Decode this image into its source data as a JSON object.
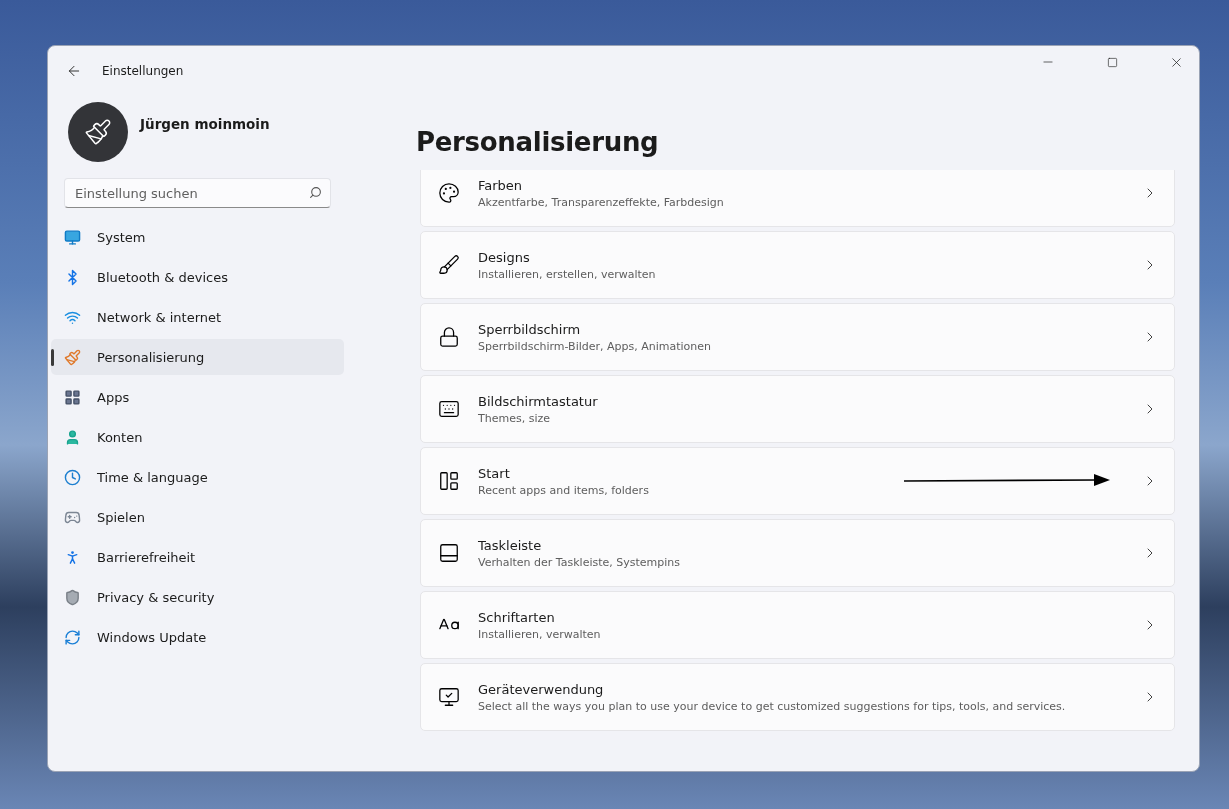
{
  "window": {
    "title": "Einstellungen"
  },
  "profile": {
    "name": "Jürgen moinmoin"
  },
  "search": {
    "placeholder": "Einstellung suchen"
  },
  "sidebar": {
    "items": [
      {
        "label": "System",
        "selected": false
      },
      {
        "label": "Bluetooth & devices",
        "selected": false
      },
      {
        "label": "Network & internet",
        "selected": false
      },
      {
        "label": "Personalisierung",
        "selected": true
      },
      {
        "label": "Apps",
        "selected": false
      },
      {
        "label": "Konten",
        "selected": false
      },
      {
        "label": "Time & language",
        "selected": false
      },
      {
        "label": "Spielen",
        "selected": false
      },
      {
        "label": "Barrierefreiheit",
        "selected": false
      },
      {
        "label": "Privacy & security",
        "selected": false
      },
      {
        "label": "Windows Update",
        "selected": false
      }
    ]
  },
  "page": {
    "title": "Personalisierung",
    "cards": [
      {
        "title": "Farben",
        "subtitle": "Akzentfarbe, Transparenzeffekte, Farbdesign"
      },
      {
        "title": "Designs",
        "subtitle": "Installieren, erstellen, verwalten"
      },
      {
        "title": "Sperrbildschirm",
        "subtitle": "Sperrbildschirm-Bilder, Apps, Animationen"
      },
      {
        "title": "Bildschirmtastatur",
        "subtitle": "Themes, size"
      },
      {
        "title": "Start",
        "subtitle": "Recent apps and items, folders",
        "annotated": true
      },
      {
        "title": "Taskleiste",
        "subtitle": "Verhalten der Taskleiste, Systempins"
      },
      {
        "title": "Schriftarten",
        "subtitle": "Installieren, verwalten"
      },
      {
        "title": "Geräteverwendung",
        "subtitle": "Select all the ways you plan to use your device to get customized suggestions for tips, tools, and services."
      }
    ]
  }
}
